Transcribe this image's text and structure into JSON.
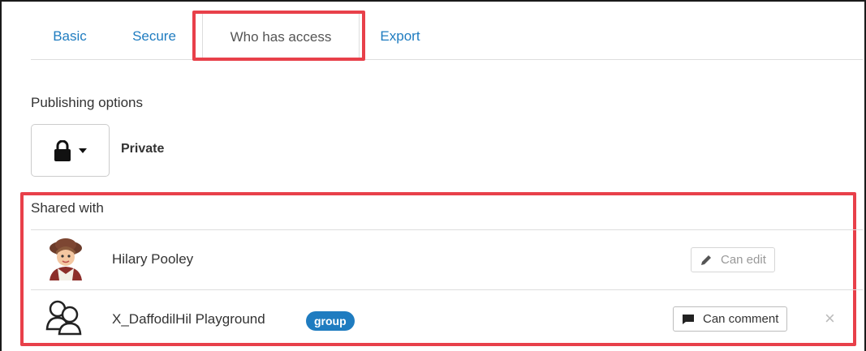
{
  "tabs": [
    {
      "label": "Basic"
    },
    {
      "label": "Secure"
    },
    {
      "label": "Who has access",
      "active": true
    },
    {
      "label": "Export"
    }
  ],
  "publishing": {
    "label": "Publishing options",
    "value": "Private",
    "icon": "lock-icon"
  },
  "shared": {
    "label": "Shared with",
    "entries": [
      {
        "name": "Hilary Pooley",
        "permission": "Can edit",
        "icon": "pencil-icon"
      },
      {
        "name": "X_DaffodilHil Playground",
        "badge": "group",
        "permission": "Can comment",
        "icon": "comment-icon",
        "remove": "×"
      }
    ]
  },
  "colors": {
    "link": "#1f7cc0",
    "highlight": "#e8404a",
    "badge": "#1f7cc0"
  }
}
